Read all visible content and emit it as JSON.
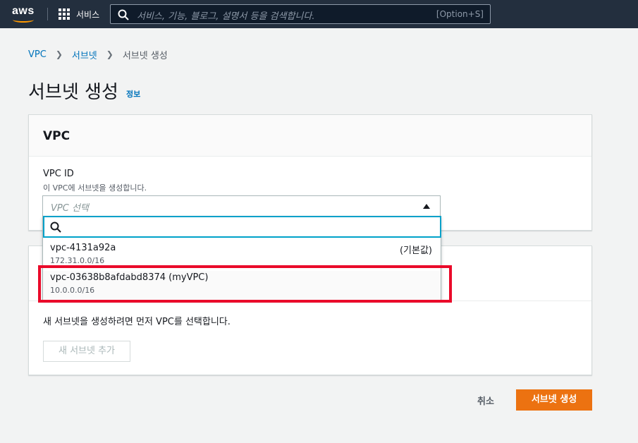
{
  "nav": {
    "logo_text": "aws",
    "services_label": "서비스",
    "search_placeholder": "서비스, 기능, 블로그, 설명서 등을 검색합니다.",
    "search_shortcut": "[Option+S]"
  },
  "breadcrumb": {
    "items": [
      "VPC",
      "서브넷"
    ],
    "current": "서브넷 생성"
  },
  "page": {
    "title": "서브넷 생성",
    "info_link": "정보"
  },
  "vpc_panel": {
    "header": "VPC",
    "field_label": "VPC ID",
    "field_description": "이 VPC에 서브넷을 생성합니다.",
    "select_placeholder": "VPC 선택",
    "options": [
      {
        "id": "vpc-4131a92a",
        "cidr": "172.31.0.0/16",
        "tag": "(기본값)"
      },
      {
        "id": "vpc-03638b8afdabd8374 (myVPC)",
        "cidr": "10.0.0.0/16",
        "tag": ""
      }
    ]
  },
  "subnet_panel": {
    "message": "새 서브넷을 생성하려면 먼저 VPC를 선택합니다.",
    "add_button": "새 서브넷 추가"
  },
  "actions": {
    "cancel": "취소",
    "create": "서브넷 생성"
  },
  "colors": {
    "nav_bg": "#232f3e",
    "link": "#0073bb",
    "primary_button": "#ec7211",
    "highlight_box": "#ea0a2a",
    "focus_ring": "#00a1c9"
  }
}
